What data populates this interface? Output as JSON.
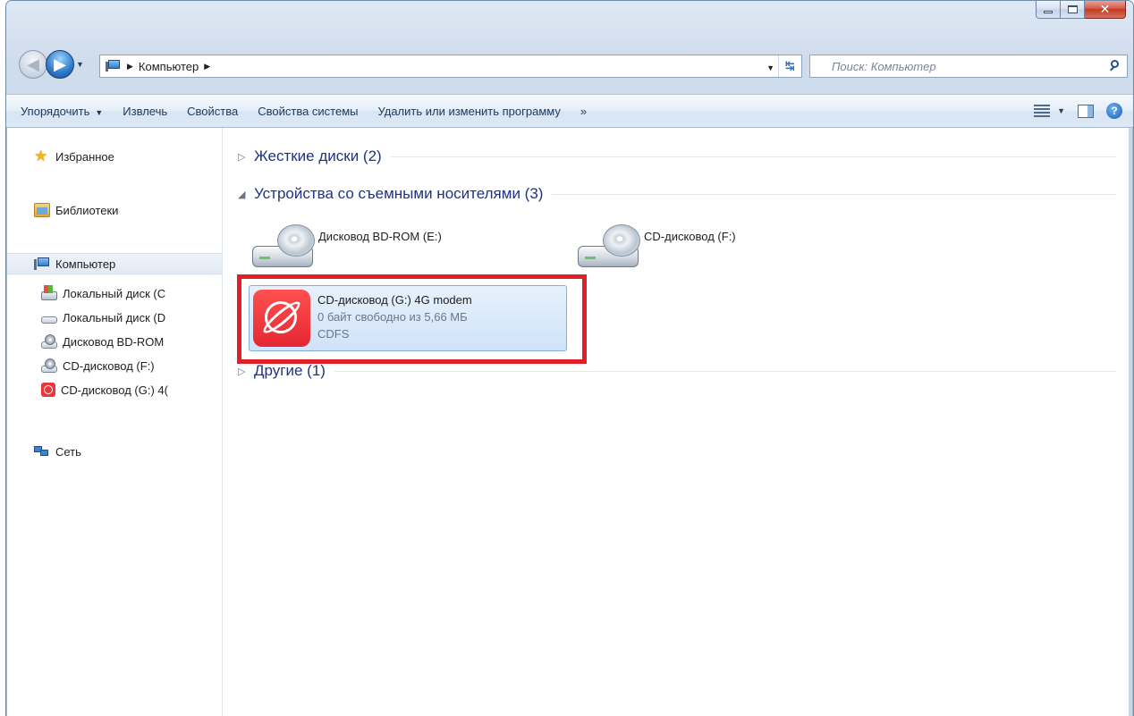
{
  "navigation": {
    "address_items": [
      "Компьютер"
    ],
    "search_placeholder": "Поиск: Компьютер"
  },
  "toolbar": {
    "organize": "Упорядочить",
    "eject": "Извлечь",
    "properties": "Свойства",
    "system_properties": "Свойства системы",
    "uninstall": "Удалить или изменить программу",
    "more": "»"
  },
  "sidebar": {
    "favorites": "Избранное",
    "libraries": "Библиотеки",
    "computer": "Компьютер",
    "children": [
      "Локальный диск (C",
      "Локальный диск (D",
      "Дисковод BD-ROM",
      "CD-дисковод (F:)",
      "CD-дисковод (G:) 4("
    ],
    "network": "Сеть"
  },
  "main": {
    "groups": [
      {
        "label": "Жесткие диски (2)",
        "expanded": false
      },
      {
        "label": "Устройства со съемными носителями (3)",
        "expanded": true
      },
      {
        "label": "Другие (1)",
        "expanded": false
      }
    ],
    "devices": [
      {
        "label": "Дисковод BD-ROM (E:)"
      },
      {
        "label": "CD-дисковод (F:)"
      },
      {
        "label": "CD-дисковод (G:) 4G modem",
        "free_space": "0 байт свободно из 5,66 МБ",
        "filesystem": "CDFS"
      }
    ]
  },
  "colors": {
    "highlight": "#e21f26",
    "group_text": "#1e3287",
    "modem_icon": "#e42733"
  }
}
